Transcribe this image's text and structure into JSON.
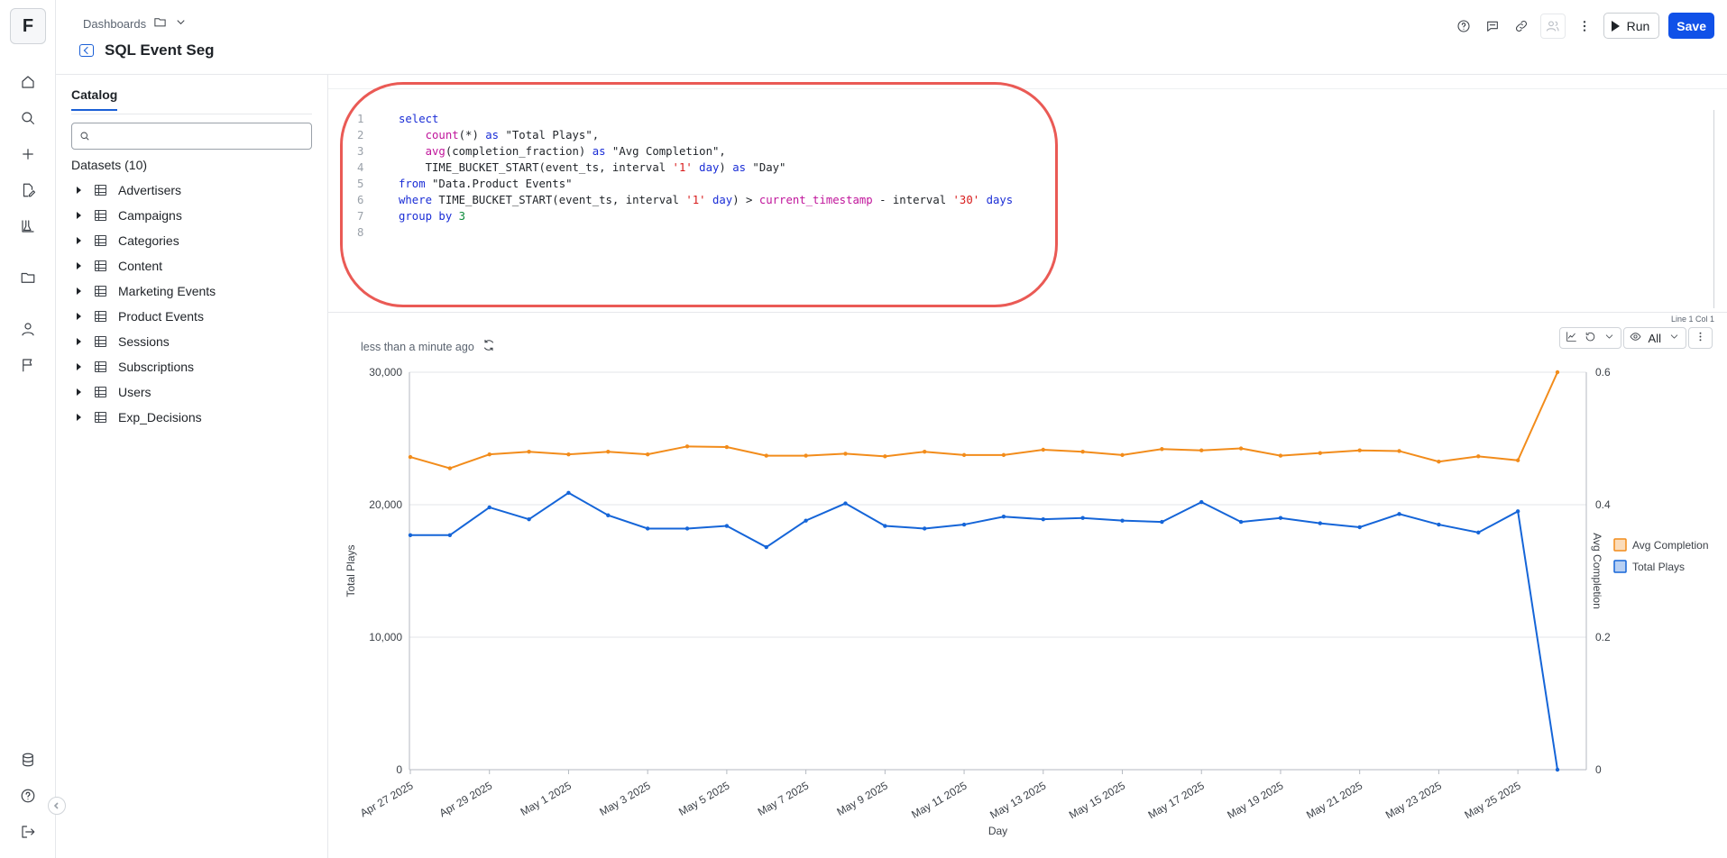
{
  "app": {
    "logo_letter": "F"
  },
  "topbar": {
    "breadcrumb": "Dashboards",
    "title": "SQL Event Seg",
    "run_label": "Run",
    "save_label": "Save"
  },
  "catalog": {
    "tab_label": "Catalog",
    "search_placeholder": "",
    "datasets_heading": "Datasets (10)",
    "datasets": [
      {
        "name": "Advertisers"
      },
      {
        "name": "Campaigns"
      },
      {
        "name": "Categories"
      },
      {
        "name": "Content"
      },
      {
        "name": "Marketing Events"
      },
      {
        "name": "Product Events"
      },
      {
        "name": "Sessions"
      },
      {
        "name": "Subscriptions"
      },
      {
        "name": "Users"
      },
      {
        "name": "Exp_Decisions"
      }
    ]
  },
  "editor": {
    "status": "Line 1 Col 1",
    "lines": [
      {
        "n": "1",
        "tokens": [
          {
            "t": "select",
            "c": "kw"
          }
        ]
      },
      {
        "n": "2",
        "tokens": [
          {
            "t": "    ",
            "c": "op"
          },
          {
            "t": "count",
            "c": "fn"
          },
          {
            "t": "(*) ",
            "c": "op"
          },
          {
            "t": "as",
            "c": "kw"
          },
          {
            "t": " \"Total Plays\",",
            "c": "op"
          }
        ]
      },
      {
        "n": "3",
        "tokens": [
          {
            "t": "    ",
            "c": "op"
          },
          {
            "t": "avg",
            "c": "fn"
          },
          {
            "t": "(completion_fraction) ",
            "c": "op"
          },
          {
            "t": "as",
            "c": "kw"
          },
          {
            "t": " \"Avg Completion\",",
            "c": "op"
          }
        ]
      },
      {
        "n": "4",
        "tokens": [
          {
            "t": "    TIME_BUCKET_START(event_ts, interval ",
            "c": "op"
          },
          {
            "t": "'1'",
            "c": "str"
          },
          {
            "t": " ",
            "c": "op"
          },
          {
            "t": "day",
            "c": "kw"
          },
          {
            "t": ") ",
            "c": "op"
          },
          {
            "t": "as",
            "c": "kw"
          },
          {
            "t": " \"Day\"",
            "c": "op"
          }
        ]
      },
      {
        "n": "5",
        "tokens": [
          {
            "t": "from",
            "c": "kw"
          },
          {
            "t": " \"Data.Product Events\"",
            "c": "op"
          }
        ]
      },
      {
        "n": "6",
        "tokens": [
          {
            "t": "where",
            "c": "kw"
          },
          {
            "t": " TIME_BUCKET_START(event_ts, interval ",
            "c": "op"
          },
          {
            "t": "'1'",
            "c": "str"
          },
          {
            "t": " ",
            "c": "op"
          },
          {
            "t": "day",
            "c": "kw"
          },
          {
            "t": ") > ",
            "c": "op"
          },
          {
            "t": "current_timestamp",
            "c": "fn"
          },
          {
            "t": " - interval ",
            "c": "op"
          },
          {
            "t": "'30'",
            "c": "str"
          },
          {
            "t": " ",
            "c": "op"
          },
          {
            "t": "days",
            "c": "kw"
          }
        ]
      },
      {
        "n": "7",
        "tokens": [
          {
            "t": "group by",
            "c": "kw"
          },
          {
            "t": " ",
            "c": "op"
          },
          {
            "t": "3",
            "c": "num"
          }
        ]
      },
      {
        "n": "8",
        "tokens": []
      }
    ]
  },
  "results": {
    "updated_text": "less than a minute ago",
    "visibility_label": "All"
  },
  "colors": {
    "accent": "#1051e8",
    "total_plays": "#1565d8",
    "avg_completion": "#f28c1b",
    "highlight": "#ea5a55"
  },
  "chart_data": {
    "type": "line",
    "xlabel": "Day",
    "ylabel_left": "Total Plays",
    "ylabel_right": "Avg Completion",
    "ylim_left": [
      0,
      30000
    ],
    "ylim_right": [
      0,
      0.6
    ],
    "yticks_left": [
      "0",
      "10,000",
      "20,000",
      "30,000"
    ],
    "yticks_right": [
      "0",
      "0.2",
      "0.4",
      "0.6"
    ],
    "grid": true,
    "legend": "right",
    "x": [
      "2025-04-27",
      "2025-04-28",
      "2025-04-29",
      "2025-04-30",
      "2025-05-01",
      "2025-05-02",
      "2025-05-03",
      "2025-05-04",
      "2025-05-05",
      "2025-05-06",
      "2025-05-07",
      "2025-05-08",
      "2025-05-09",
      "2025-05-10",
      "2025-05-11",
      "2025-05-12",
      "2025-05-13",
      "2025-05-14",
      "2025-05-15",
      "2025-05-16",
      "2025-05-17",
      "2025-05-18",
      "2025-05-19",
      "2025-05-20",
      "2025-05-21",
      "2025-05-22",
      "2025-05-23",
      "2025-05-24",
      "2025-05-25",
      "2025-05-26"
    ],
    "xtick_labels": [
      "Apr 27 2025",
      "Apr 29 2025",
      "May 1 2025",
      "May 3 2025",
      "May 5 2025",
      "May 7 2025",
      "May 9 2025",
      "May 11 2025",
      "May 13 2025",
      "May 15 2025",
      "May 17 2025",
      "May 19 2025",
      "May 21 2025",
      "May 23 2025",
      "May 25 2025"
    ],
    "series": [
      {
        "name": "Avg Completion",
        "axis": "right",
        "color": "#f28c1b",
        "values": [
          0.472,
          0.455,
          0.476,
          0.48,
          0.476,
          0.48,
          0.476,
          0.488,
          0.487,
          0.474,
          0.474,
          0.477,
          0.473,
          0.48,
          0.475,
          0.475,
          0.483,
          0.48,
          0.475,
          0.484,
          0.482,
          0.485,
          0.474,
          0.478,
          0.482,
          0.481,
          0.465,
          0.473,
          0.467,
          0.6
        ]
      },
      {
        "name": "Total Plays",
        "axis": "left",
        "color": "#1565d8",
        "values": [
          17700,
          17700,
          19800,
          18900,
          20900,
          19200,
          18200,
          18200,
          18400,
          16800,
          18800,
          20100,
          18400,
          18200,
          18500,
          19100,
          18900,
          19000,
          18800,
          18700,
          20200,
          18700,
          19000,
          18600,
          18300,
          19300,
          18500,
          17900,
          19500,
          0
        ]
      }
    ]
  }
}
